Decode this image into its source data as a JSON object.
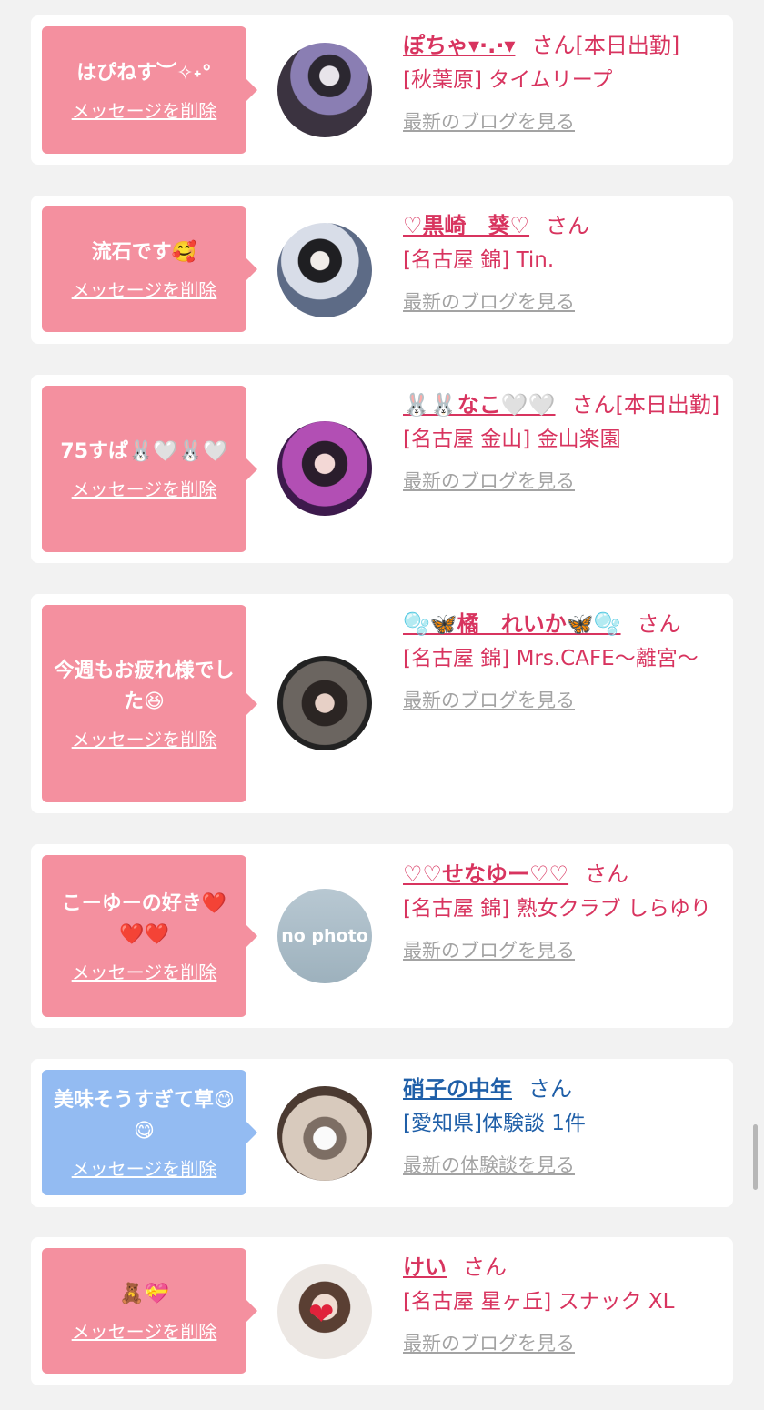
{
  "messages": [
    {
      "message": "はぴねす︶✧˖°",
      "delete_label": "メッセージを削除",
      "name": "ぽちゃ▾·.·▾",
      "honorific": "さん",
      "status": "[本日出勤]",
      "shop": "[秋葉原] タイムリープ",
      "link_label": "最新のブログを見る",
      "bubble_color": "#f4909f",
      "avatar": "woman-photo"
    },
    {
      "message": "流石です🥰",
      "delete_label": "メッセージを削除",
      "name": "♡黒崎　葵♡",
      "honorific": "さん",
      "status": "",
      "shop": "[名古屋 錦] Tin.",
      "link_label": "最新のブログを見る",
      "bubble_color": "#f4909f",
      "avatar": "woman-photo"
    },
    {
      "message": "75すぱ🐰🤍🐰🤍",
      "delete_label": "メッセージを削除",
      "name": "🐰🐰なこ🤍🤍",
      "honorific": "さん",
      "status": "[本日出勤]",
      "shop": "[名古屋 金山] 金山楽園",
      "link_label": "最新のブログを見る",
      "bubble_color": "#f4909f",
      "avatar": "woman-photo"
    },
    {
      "message": "今週もお疲れ様でした😆",
      "delete_label": "メッセージを削除",
      "name": "🫧🦋橘　れいか🦋🫧",
      "honorific": "さん",
      "status": "",
      "shop": "[名古屋 錦] Mrs.CAFE〜離宮〜",
      "link_label": "最新のブログを見る",
      "bubble_color": "#f4909f",
      "avatar": "woman-photo"
    },
    {
      "message": "こーゆーの好き❤️❤️❤️",
      "delete_label": "メッセージを削除",
      "name": "♡♡せなゆー♡♡",
      "honorific": "さん",
      "status": "",
      "shop": "[名古屋 錦] 熟女クラブ しらゆり",
      "link_label": "最新のブログを見る",
      "bubble_color": "#f4909f",
      "avatar": "no-photo",
      "avatar_text": "no photo"
    },
    {
      "message": "美味そうすぎて草😋😋",
      "delete_label": "メッセージを削除",
      "name": "硝子の中年",
      "honorific": "さん",
      "status": "",
      "shop": "[愛知県]体験談 1件",
      "link_label": "最新の体験談を見る",
      "bubble_color": "#93bbf2",
      "avatar": "cat-photo"
    },
    {
      "message": "🧸💝",
      "delete_label": "メッセージを削除",
      "name": "けい",
      "honorific": "さん",
      "status": "",
      "shop": "[名古屋 星ヶ丘] スナック XL",
      "link_label": "最新のブログを見る",
      "bubble_color": "#f4909f",
      "avatar": "woman-photo-heart"
    }
  ],
  "colors": {
    "page_background": "#f2f2f2",
    "card_background": "#ffffff",
    "pink_text": "#d8345f",
    "blue_text": "#1f5fa8",
    "link_gray": "#a3a3a3"
  }
}
